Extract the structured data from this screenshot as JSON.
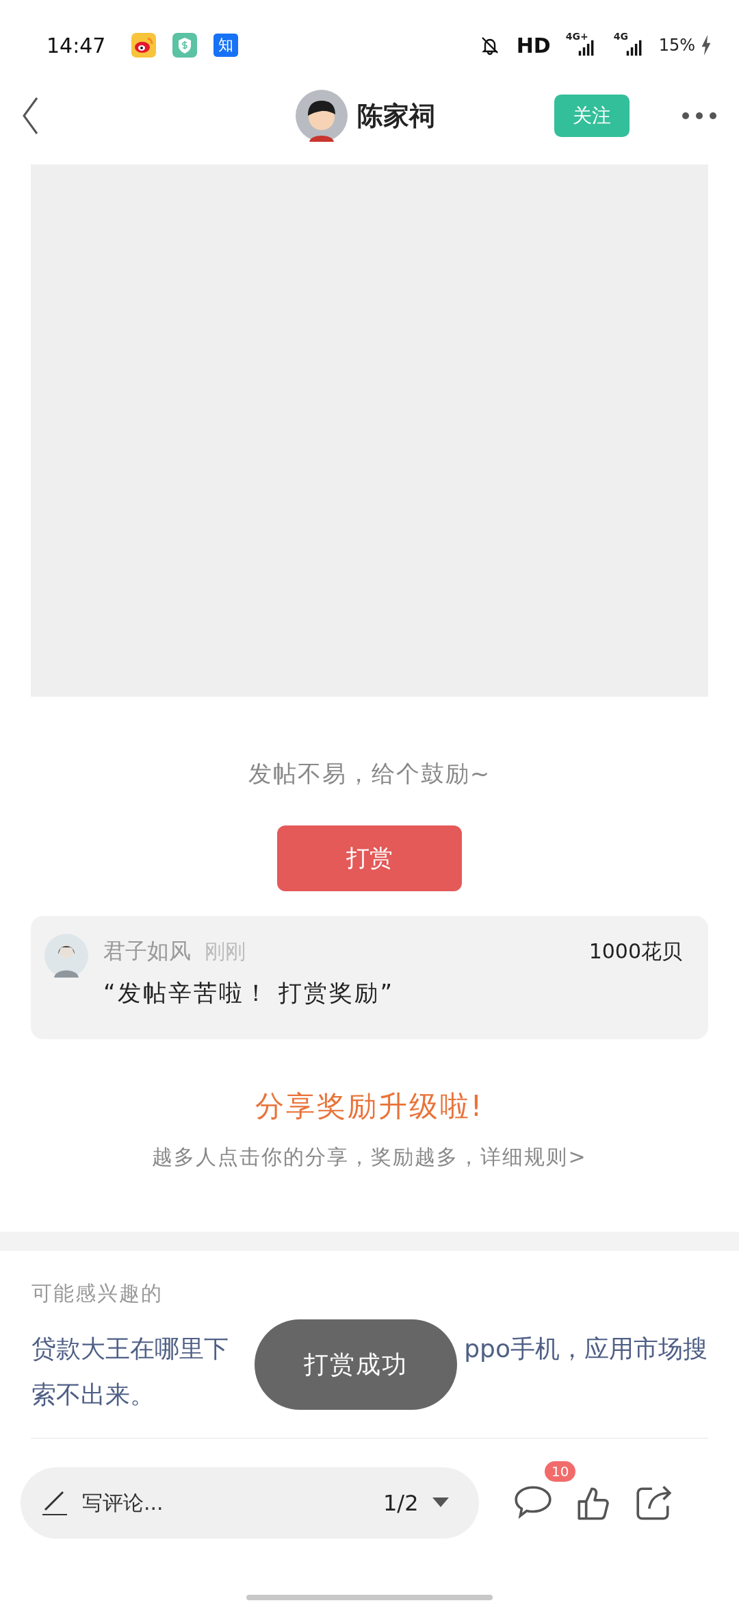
{
  "status_bar": {
    "time": "14:47",
    "app_icons": [
      {
        "kind": "weibo"
      },
      {
        "kind": "wallet"
      },
      {
        "kind": "zhihu",
        "label": "知"
      }
    ],
    "network_label": "HD",
    "signal_labels": [
      "4G+",
      "4G"
    ],
    "battery": "15%",
    "charging": true,
    "muted": true
  },
  "header": {
    "author": "陈家祠",
    "follow_button": "关注"
  },
  "post": {
    "image": {
      "kind": "placeholder"
    }
  },
  "reward": {
    "prompt": "发帖不易，给个鼓励~",
    "button": "打赏"
  },
  "reward_record": {
    "user": "君子如风",
    "time": "刚刚",
    "amount": "1000花贝",
    "message": "“发帖辛苦啦！ 打赏奖励”"
  },
  "share": {
    "title": "分享奖励升级啦!",
    "rule": "越多人点击你的分享，奖励越多，详细规则>"
  },
  "recommended": {
    "heading": "可能感兴趣的",
    "items": [
      {
        "title_start": "贷款大王在哪里下",
        "title_end": "ppo手机，应用市场搜",
        "title_line_2": "索不出来。"
      }
    ]
  },
  "toast": "打赏成功",
  "bottom_bar": {
    "comment_placeholder": "写评论...",
    "page": "1/2",
    "comment_count": "10"
  }
}
